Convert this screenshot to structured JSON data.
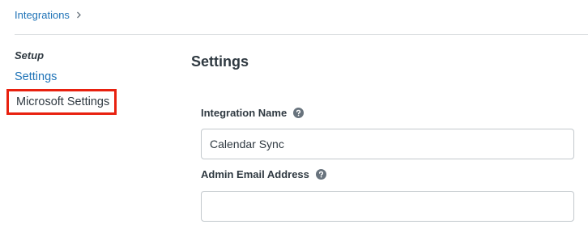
{
  "breadcrumb": {
    "items": [
      "Integrations"
    ]
  },
  "sidebar": {
    "heading": "Setup",
    "items": [
      {
        "label": "Settings"
      },
      {
        "label": "Microsoft Settings"
      }
    ]
  },
  "main": {
    "title": "Settings",
    "fields": {
      "integration_name": {
        "label": "Integration Name",
        "value": "Calendar Sync"
      },
      "admin_email": {
        "label": "Admin Email Address",
        "value": ""
      }
    }
  },
  "colors": {
    "link": "#1f73b7",
    "text": "#2f3941",
    "highlight_border": "#e8210f",
    "help_icon": "#68737d"
  },
  "icons": {
    "breadcrumb_separator": "chevron-right-icon",
    "field_help": "question-circle-icon"
  }
}
